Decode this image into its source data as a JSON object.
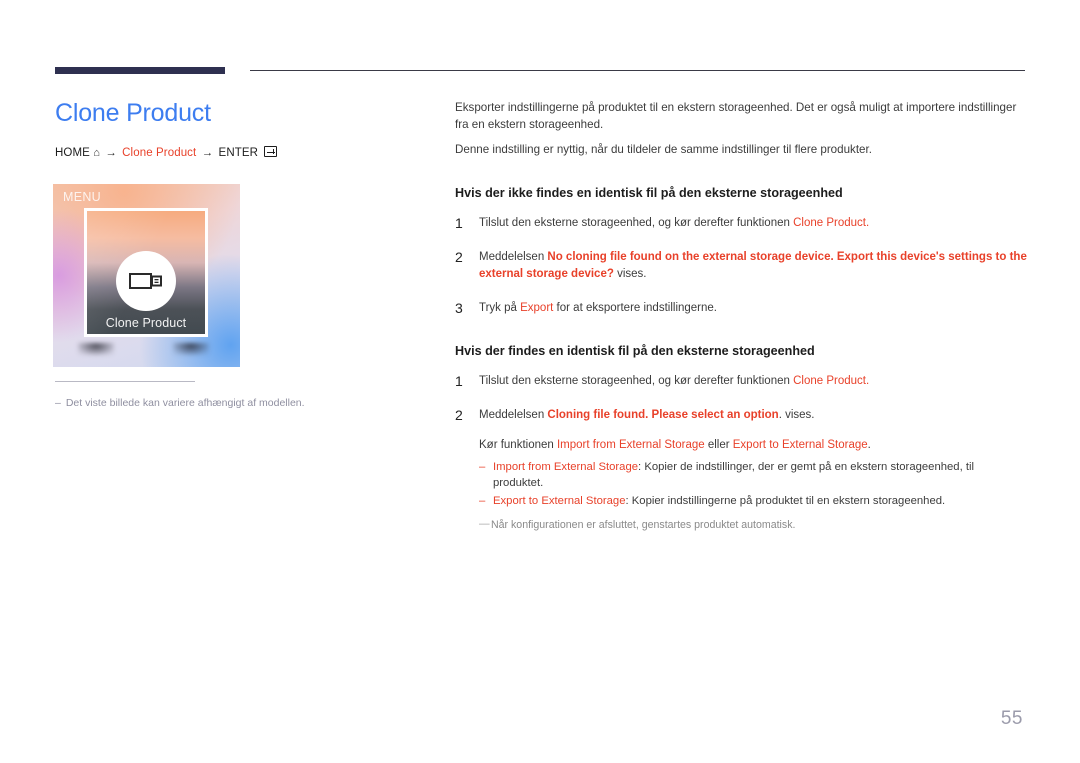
{
  "header": {
    "accent_color": "#2e3050",
    "rule_color": "#3a3a46"
  },
  "left": {
    "title": "Clone Product",
    "title_color": "#3d7df0",
    "breadcrumb": {
      "home_label": "HOME",
      "home_icon": "home-icon",
      "arrow": "→",
      "middle_label": "Clone Product",
      "enter_label": "ENTER",
      "enter_icon": "enter-key-icon"
    },
    "figure": {
      "menu_label": "MENU",
      "screen_label": "Clone Product",
      "icon": "usb-drive-icon"
    },
    "figure_note": {
      "dash": "–",
      "text": "Det viste billede kan variere afhængigt af modellen."
    }
  },
  "right": {
    "intro": [
      "Eksporter indstillingerne på produktet til en ekstern storageenhed. Det er også muligt at importere indstillinger fra en ekstern storageenhed.",
      "Denne indstilling er nyttig, når du tildeler de samme indstillinger til flere produkter."
    ],
    "section_1": {
      "heading": "Hvis der ikke findes en identisk fil på den eksterne storageenhed",
      "steps": [
        {
          "num": "1",
          "parts": [
            {
              "t": "Tilslut den eksterne storageenhed, og kør derefter funktionen ",
              "s": "plain"
            },
            {
              "t": "Clone Product",
              "s": "accent"
            },
            {
              "t": ".",
              "s": "accent"
            }
          ]
        },
        {
          "num": "2",
          "parts": [
            {
              "t": "Meddelelsen ",
              "s": "plain"
            },
            {
              "t": "No cloning file found on the external storage device. Export this device's settings to the external storage device?",
              "s": "accent-bold"
            },
            {
              "t": " vises.",
              "s": "plain"
            }
          ]
        },
        {
          "num": "3",
          "parts": [
            {
              "t": "Tryk på ",
              "s": "plain"
            },
            {
              "t": "Export",
              "s": "accent"
            },
            {
              "t": " for at eksportere indstillingerne.",
              "s": "plain"
            }
          ]
        }
      ]
    },
    "section_2": {
      "heading": "Hvis der findes en identisk fil på den eksterne storageenhed",
      "steps": [
        {
          "num": "1",
          "parts": [
            {
              "t": "Tilslut den eksterne storageenhed, og kør derefter funktionen ",
              "s": "plain"
            },
            {
              "t": "Clone Product",
              "s": "accent"
            },
            {
              "t": ".",
              "s": "accent"
            }
          ]
        },
        {
          "num": "2",
          "parts": [
            {
              "t": "Meddelelsen ",
              "s": "plain"
            },
            {
              "t": "Cloning file found. Please select an option",
              "s": "accent-bold"
            },
            {
              "t": ". vises.",
              "s": "plain"
            }
          ]
        }
      ],
      "sub_para": {
        "lead": "Kør funktionen ",
        "option_1": "Import from External Storage",
        "joiner": " eller ",
        "option_2": "Export to External Storage",
        "tail": "."
      },
      "dash_items": [
        {
          "mark": "–",
          "term": "Import from External Storage",
          "desc": ": Kopier de indstillinger, der er gemt på en ekstern storageenhed, til produktet."
        },
        {
          "mark": "–",
          "term": "Export to External Storage",
          "desc": ": Kopier indstillingerne på produktet til en ekstern storageenhed."
        }
      ],
      "grey_note": {
        "mark": "—",
        "text": "Når konfigurationen er afsluttet, genstartes produktet automatisk."
      }
    }
  },
  "footer": {
    "page_number": "55"
  },
  "colors": {
    "accent_red": "#e8412a",
    "title_blue": "#3d7df0",
    "body_grey": "#3c3c3c",
    "note_grey": "#8a8a8a",
    "page_num_grey": "#9b9bab"
  }
}
